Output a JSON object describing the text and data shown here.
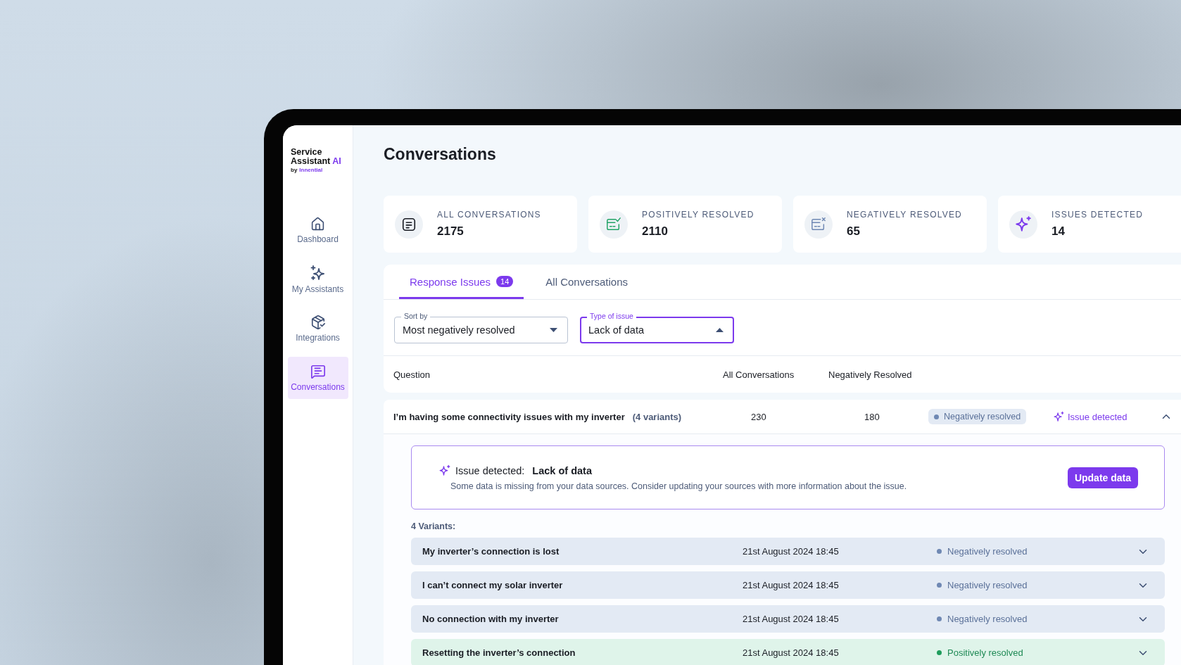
{
  "sidebar": {
    "logo": {
      "line1": "Service",
      "line2": "Assistant",
      "accent": "AI",
      "by": "by",
      "brand": "Innential"
    },
    "items": [
      {
        "label": "Dashboard",
        "kind": "home",
        "selected": false
      },
      {
        "label": "My Assistants",
        "kind": "sparkles",
        "selected": false
      },
      {
        "label": "Integrations",
        "kind": "package",
        "selected": false
      },
      {
        "label": "Conversations",
        "kind": "chat",
        "selected": true
      }
    ]
  },
  "page_title": "Conversations",
  "stats": [
    {
      "label": "ALL CONVERSATIONS",
      "value": "2175",
      "kind": "document"
    },
    {
      "label": "POSITIVELY RESOLVED",
      "value": "2110",
      "kind": "positive"
    },
    {
      "label": "NEGATIVELY RESOLVED",
      "value": "65",
      "kind": "negative"
    },
    {
      "label": "ISSUES DETECTED",
      "value": "14",
      "kind": "issue"
    }
  ],
  "tabs": [
    {
      "label": "Response Issues",
      "badge": "14",
      "selected": true
    },
    {
      "label": "All Conversations",
      "selected": false
    }
  ],
  "filters": [
    {
      "label": "Sort by",
      "value": "Most negatively resolved",
      "open": false
    },
    {
      "label": "Type of issue",
      "value": "Lack of data",
      "open": true
    }
  ],
  "table": {
    "columns": [
      "Question",
      "All Conversations",
      "Negatively Resolved"
    ],
    "rows": [
      {
        "question": "I’m having some connectivity issues with my inverter",
        "variants_count": "(4 variants)",
        "all": "230",
        "negative": "180",
        "status": {
          "label": "Negatively resolved",
          "kind": "negative"
        },
        "issue": "Issue detected",
        "expanded": true,
        "detail": {
          "issue_label": "Issue detected:",
          "issue_type": "Lack of data",
          "description": "Some data is missing from your data sources. Consider updating your sources with more information about the issue.",
          "button": "Update data",
          "variants_title": "4 Variants:",
          "variants": [
            {
              "question": "My inverter’s connection is lost",
              "date": "21st August 2024 18:45",
              "status": {
                "label": "Negatively resolved",
                "kind": "negative"
              },
              "expanded": false
            },
            {
              "question": "I can’t connect my solar inverter",
              "date": "21st August 2024 18:45",
              "status": {
                "label": "Negatively resolved",
                "kind": "negative"
              },
              "expanded": false
            },
            {
              "question": "No connection with my inverter",
              "date": "21st August 2024 18:45",
              "status": {
                "label": "Negatively resolved",
                "kind": "negative"
              },
              "expanded": false
            },
            {
              "question": "Resetting the inverter’s connection",
              "date": "21st August 2024 18:45",
              "status": {
                "label": "Positively resolved",
                "kind": "positive"
              },
              "expanded": false
            }
          ]
        }
      }
    ]
  }
}
